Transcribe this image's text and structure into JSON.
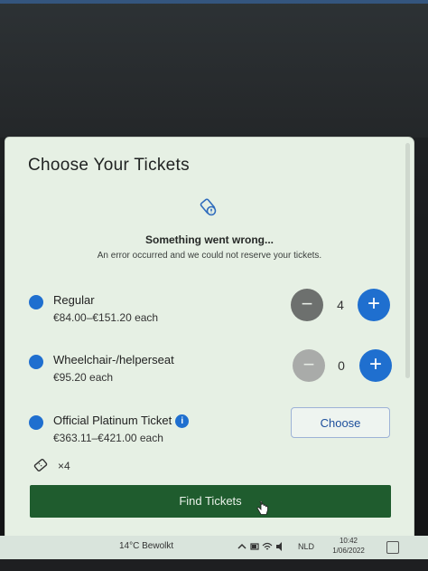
{
  "modal": {
    "title": "Choose Your Tickets",
    "error_icon": "ticket-warning-icon",
    "error_title": "Something went wrong...",
    "error_description": "An error occurred and we could not reserve your tickets.",
    "tickets": [
      {
        "name": "Regular",
        "price": "€84.00–€151.20 each",
        "quantity": "4",
        "minus_label": "−",
        "plus_label": "+"
      },
      {
        "name": "Wheelchair-/helperseat",
        "price": "€95.20 each",
        "quantity": "0",
        "minus_label": "−",
        "plus_label": "+"
      },
      {
        "name": "Official Platinum Ticket",
        "price": "€363.11–€421.00 each",
        "info_label": "i",
        "choose_label": "Choose"
      }
    ],
    "ticket_count": "×4",
    "find_button": "Find Tickets"
  },
  "taskbar": {
    "weather": "14°C Bewolkt",
    "language": "NLD",
    "time": "10:42",
    "date": "1/06/2022"
  },
  "colors": {
    "accent": "#1f6fcf",
    "primary_button": "#1f5c2e",
    "modal_bg": "#e6f0e4"
  }
}
